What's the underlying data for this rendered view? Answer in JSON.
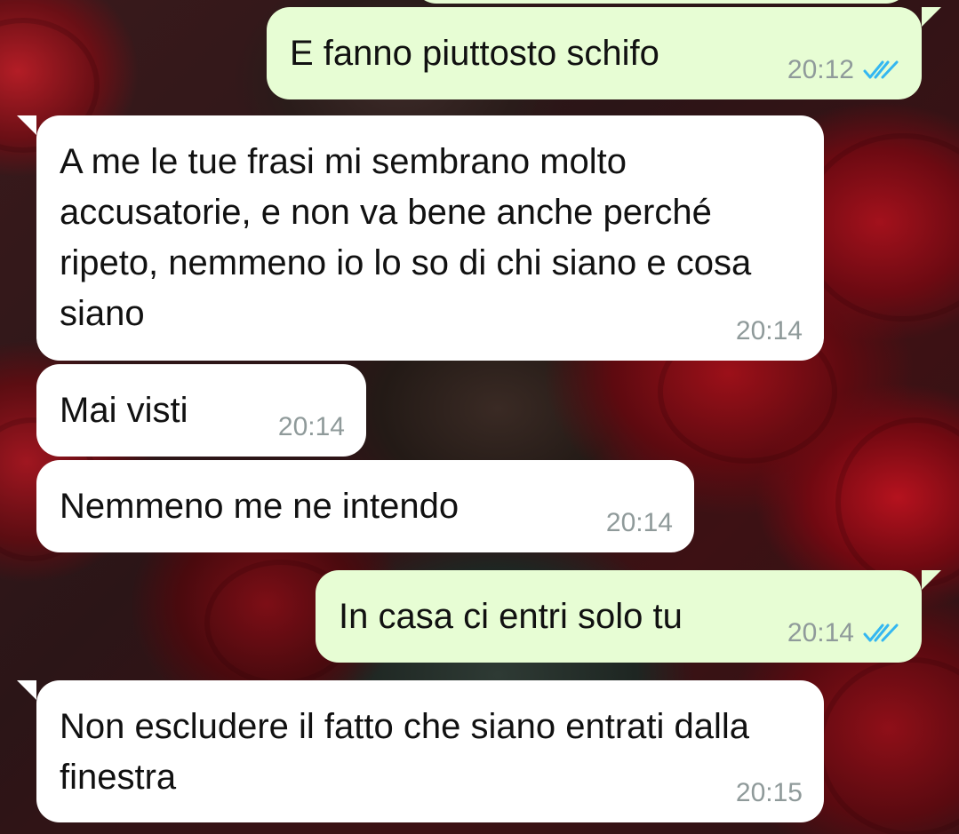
{
  "chat": {
    "messages": [
      {
        "direction": "outgoing",
        "text": "E fanno piuttosto schifo",
        "time": "20:12",
        "status": "read"
      },
      {
        "direction": "incoming",
        "text": "A me le tue frasi mi sembrano molto accusatorie, e non va bene anche perché ripeto, nemmeno io lo so di chi siano e cosa siano",
        "time": "20:14"
      },
      {
        "direction": "incoming",
        "text": "Mai visti",
        "time": "20:14"
      },
      {
        "direction": "incoming",
        "text": "Nemmeno me ne intendo",
        "time": "20:14"
      },
      {
        "direction": "outgoing",
        "text": "In casa ci entri solo tu",
        "time": "20:14",
        "status": "read"
      },
      {
        "direction": "incoming",
        "text": "Non escludere il fatto che siano entrati dalla finestra",
        "time": "20:15"
      }
    ]
  },
  "icons": {
    "read_receipt": "double-check-icon"
  },
  "colors": {
    "incoming_bubble": "#ffffff",
    "outgoing_bubble": "#e7fdd4",
    "timestamp": "#8f9a9a",
    "read_ticks": "#34b7f1"
  }
}
